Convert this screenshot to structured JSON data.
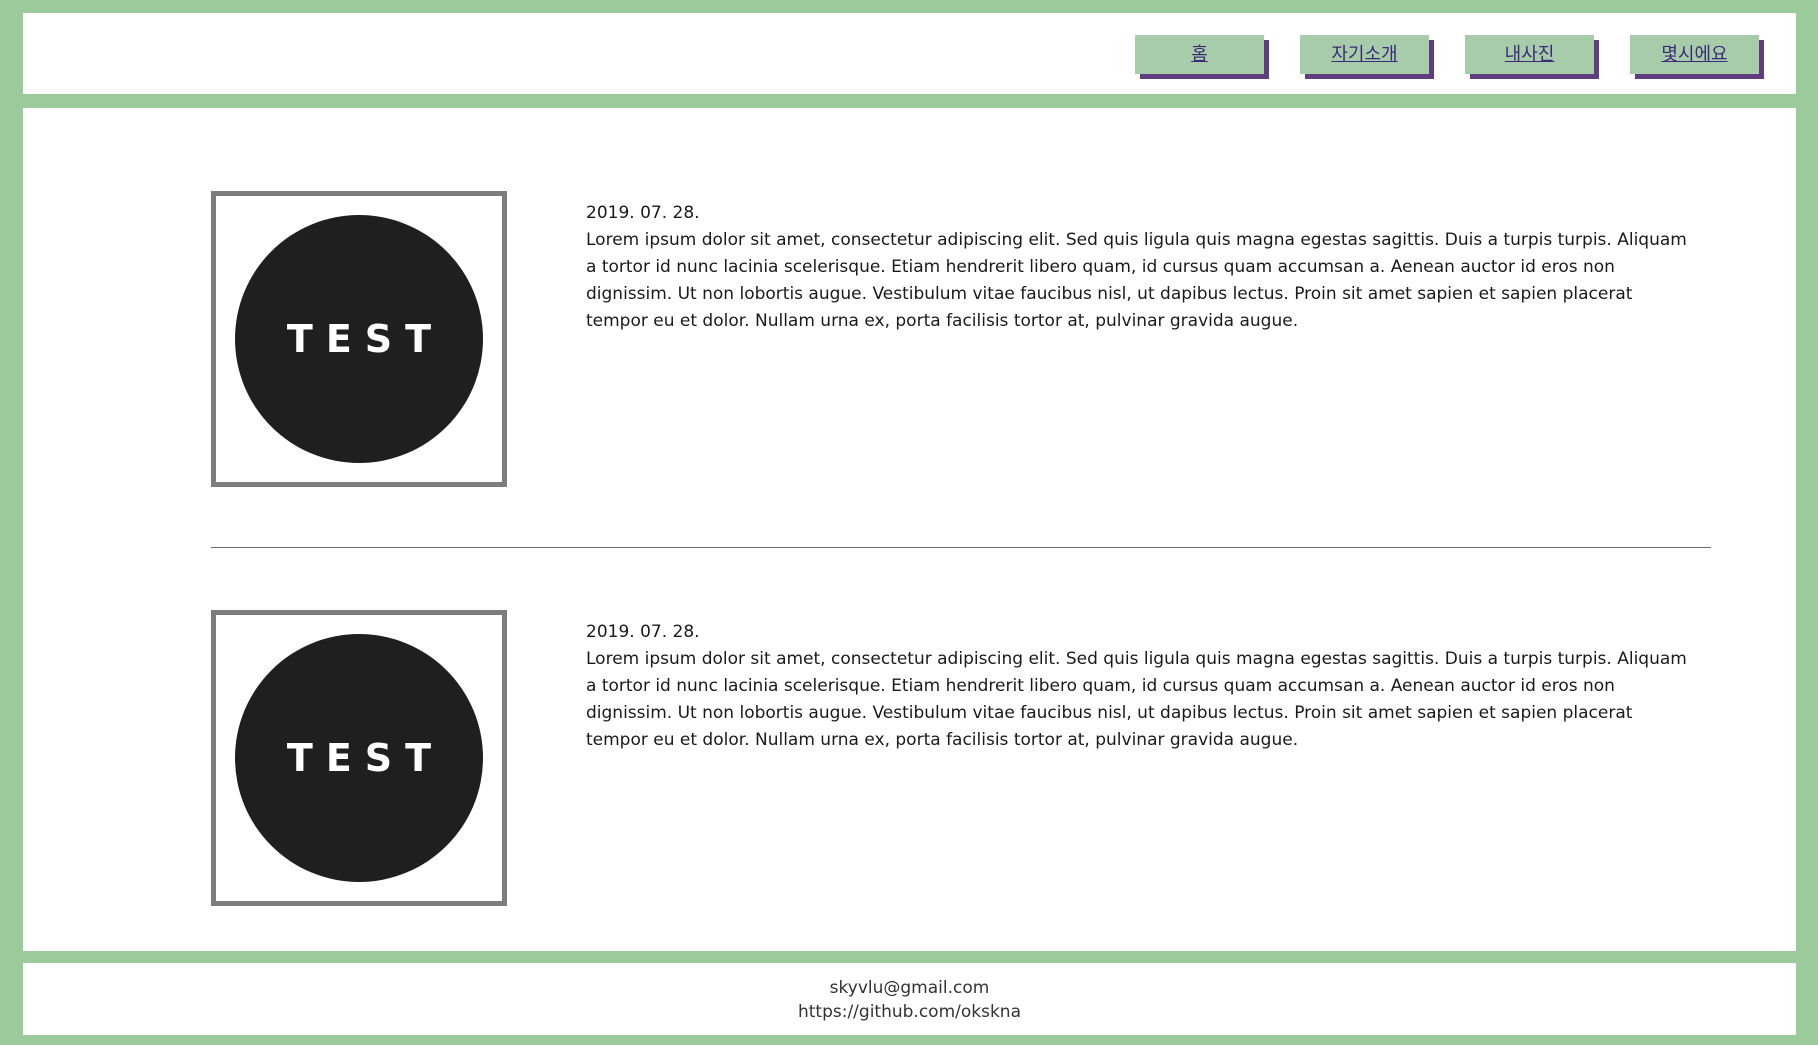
{
  "nav": {
    "items": [
      {
        "label": "홈"
      },
      {
        "label": "자기소개"
      },
      {
        "label": "내사진"
      },
      {
        "label": "몇시에요"
      }
    ]
  },
  "posts": [
    {
      "thumb_label": "TEST",
      "date": "2019. 07. 28.",
      "body": "Lorem ipsum dolor sit amet, consectetur adipiscing elit. Sed quis ligula quis magna egestas sagittis. Duis a turpis turpis. Aliquam a tortor id nunc lacinia scelerisque. Etiam hendrerit libero quam, id cursus quam accumsan a. Aenean auctor id eros non dignissim. Ut non lobortis augue. Vestibulum vitae faucibus nisl, ut dapibus lectus. Proin sit amet sapien et sapien placerat tempor eu et dolor. Nullam urna ex, porta facilisis tortor at, pulvinar gravida augue."
    },
    {
      "thumb_label": "TEST",
      "date": "2019. 07. 28.",
      "body": "Lorem ipsum dolor sit amet, consectetur adipiscing elit. Sed quis ligula quis magna egestas sagittis. Duis a turpis turpis. Aliquam a tortor id nunc lacinia scelerisque. Etiam hendrerit libero quam, id cursus quam accumsan a. Aenean auctor id eros non dignissim. Ut non lobortis augue. Vestibulum vitae faucibus nisl, ut dapibus lectus. Proin sit amet sapien et sapien placerat tempor eu et dolor. Nullam urna ex, porta facilisis tortor at, pulvinar gravida augue."
    }
  ],
  "footer": {
    "email": "skyvlu@gmail.com",
    "github": "https://github.com/okskna"
  },
  "colors": {
    "frame": "#9bcb9a",
    "nav_button": "#a7cca9",
    "nav_shadow": "#5f3d7e",
    "nav_text": "#3b2a7a",
    "thumb_border": "#7d7d7d",
    "thumb_circle": "#1f1f1f"
  }
}
